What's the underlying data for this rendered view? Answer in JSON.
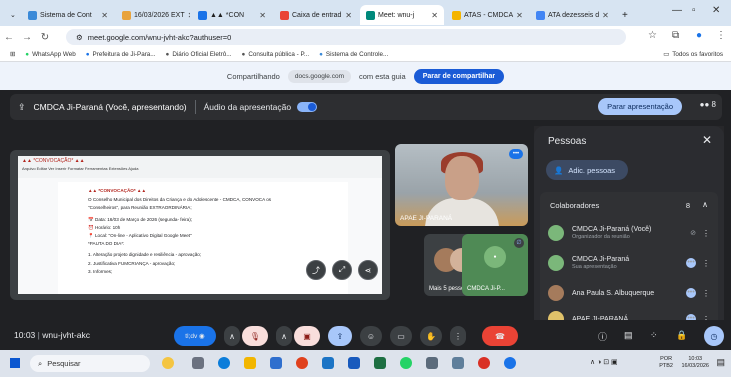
{
  "browser": {
    "tabs": [
      {
        "label": "Sistema de Cont",
        "color": "#3b8ad8"
      },
      {
        "label": "16/03/2026 EXT",
        "color": "#e8a33d"
      },
      {
        "label": "▲▲ *CON",
        "color": "#1a73e8"
      },
      {
        "label": "Caixa de entrad",
        "color": "#ea4335"
      },
      {
        "label": "Meet: wnu-j",
        "color": "#00897b",
        "active": true
      },
      {
        "label": "ATAS - CMDCA",
        "color": "#f4b400"
      },
      {
        "label": "ATA dezesseis d",
        "color": "#4285f4"
      }
    ],
    "new_tab": "+",
    "url": "meet.google.com/wnu-jvht-akc?authuser=0",
    "bookmarks": [
      "WhatsApp Web",
      "Prefeitura de Ji-Para...",
      "Diário Oficial Eletrô...",
      "Consulta pública - P...",
      "Sistema de Controle..."
    ],
    "all_bookmarks": "Todos os favoritos"
  },
  "share_bar": {
    "text1": "Compartilhando",
    "domain": "docs.google.com",
    "text2": "com esta guia",
    "button": "Parar de compartilhar"
  },
  "meet": {
    "presenting_title": "CMDCA Ji-Paraná (Você, apresentando)",
    "audio_label": "Áudio da apresentação",
    "stop_presenting": "Parar apresentação",
    "people_count": "8",
    "doc": {
      "title_bar": "▲▲ *CONVOCAÇÃO* ▲▲",
      "menu": "Arquivo Editar Ver Inserir Formatar Ferramentas Extensões Ajuda",
      "heading": "▲▲ *CONVOCAÇÃO* ▲▲",
      "lines": [
        "O Conselho Municipal dos Direitos da Criança e do Adolescente - CMDCA, CONVOCA os",
        "\"Conselheiros\", para Reunião EXTRAORDINÁRIA;",
        "📅 Data: 16/03 de Março de 2026 (segunda- feira);",
        "⏰ Horário: 10h",
        "📍 Local: \"On-line - Aplicativo Digital Google Meet\"",
        "*PAUTA DO DIA*:",
        "1. Alteração projeto dignidade e resiliência - aprovação;",
        "2. Justificativa FUMCRIANÇA - aprovação;",
        "3. Informes;"
      ]
    },
    "tiles": {
      "main_label": "APAE JI-PARANÁ",
      "more_people": "Mais 5 pessoas",
      "cmdca_label": "CMDCA Ji-P..."
    }
  },
  "people_panel": {
    "title": "Pessoas",
    "add_label": "Adic. pessoas",
    "section": "Colaboradores",
    "section_count": "8",
    "members": [
      {
        "name": "CMDCA Ji-Paraná (Você)",
        "sub": "Organizador da reunião"
      },
      {
        "name": "CMDCA Ji-Paraná",
        "sub": "Sua apresentação"
      },
      {
        "name": "Ana Paula S. Albuquerque",
        "sub": ""
      },
      {
        "name": "APAE JI-PARANÁ",
        "sub": ""
      }
    ]
  },
  "controls": {
    "time": "10:03",
    "meeting_code": "wnu-jvht-akc",
    "chip_label": "tl;dv"
  },
  "taskbar": {
    "search": "Pesquisar",
    "lang1": "POR",
    "lang2": "PTB2",
    "clock_time": "10:03",
    "clock_date": "16/03/2026"
  }
}
